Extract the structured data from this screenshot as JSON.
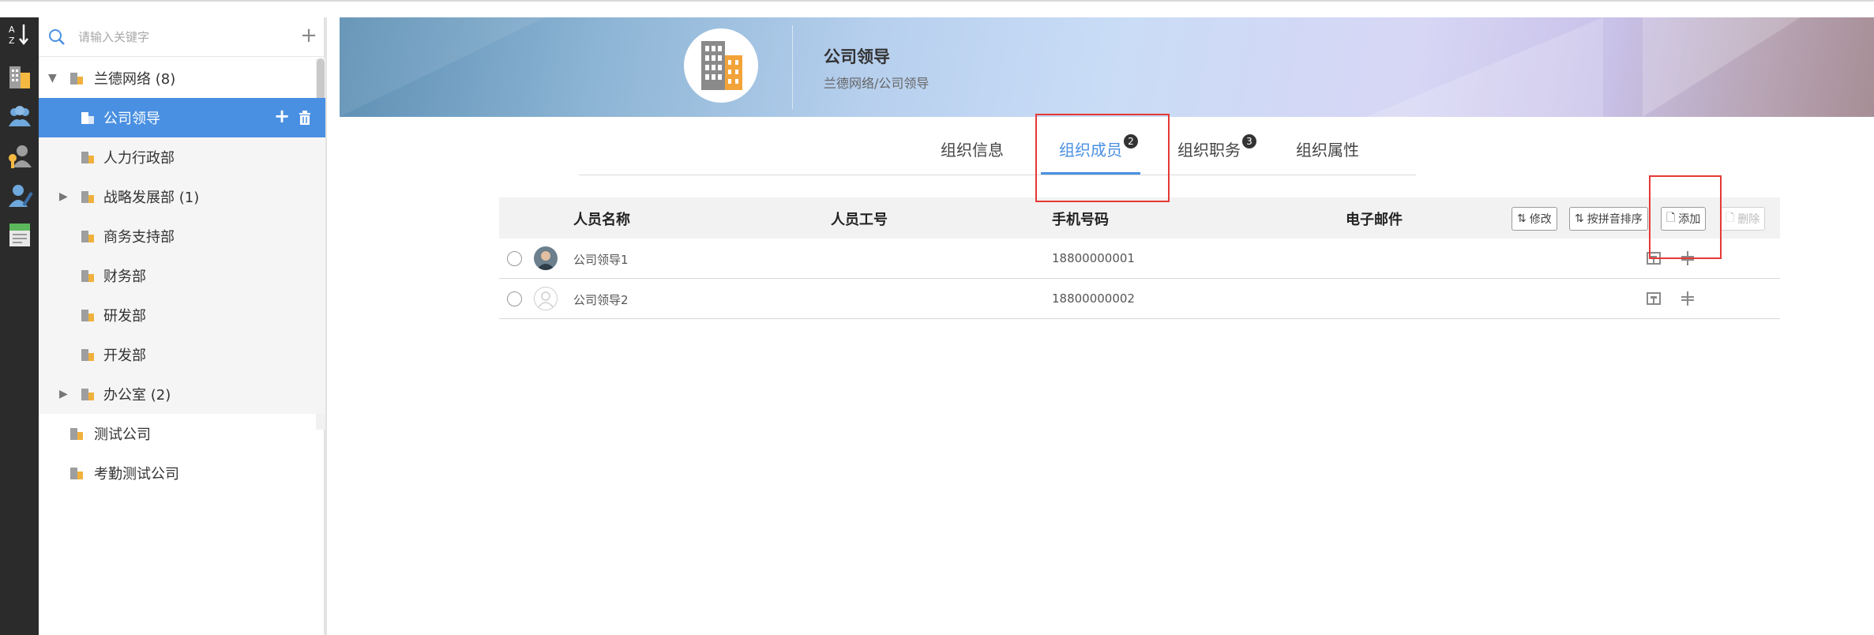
{
  "sidebar_rail": {
    "sort_icon_label": "A Z",
    "icons": [
      "sort-az-icon",
      "org-building-icon",
      "users-icon",
      "user-key-icon",
      "user-edit-icon",
      "report-icon"
    ]
  },
  "tree": {
    "search_placeholder": "请输入关键字",
    "nodes": [
      {
        "label": "兰德网络 (8)"
      },
      {
        "label": "公司领导"
      },
      {
        "label": "人力行政部"
      },
      {
        "label": "战略发展部 (1)"
      },
      {
        "label": "商务支持部"
      },
      {
        "label": "财务部"
      },
      {
        "label": "研发部"
      },
      {
        "label": "开发部"
      },
      {
        "label": "办公室 (2)"
      },
      {
        "label": "测试公司"
      },
      {
        "label": "考勤测试公司"
      }
    ]
  },
  "banner": {
    "title": "公司领导",
    "path": "兰德网络/公司领导"
  },
  "tabs": [
    {
      "label": "组织信息"
    },
    {
      "label": "组织成员",
      "badge": "2"
    },
    {
      "label": "组织职务",
      "badge": "3"
    },
    {
      "label": "组织属性"
    }
  ],
  "table": {
    "headers": [
      "人员名称",
      "人员工号",
      "手机号码",
      "电子邮件"
    ],
    "buttons": {
      "edit": "修改",
      "pinyin_sort": "按拼音排序",
      "add": "添加",
      "delete": "删除"
    },
    "rows": [
      {
        "name": "公司领导1",
        "id": "",
        "phone": "18800000001",
        "email": ""
      },
      {
        "name": "公司领导2",
        "id": "",
        "phone": "18800000002",
        "email": ""
      }
    ]
  },
  "colors": {
    "rail_bg": "#2b2b2b",
    "selected_bg": "#4a90e2",
    "accent": "#4a90e2",
    "highlight": "#e53935"
  }
}
